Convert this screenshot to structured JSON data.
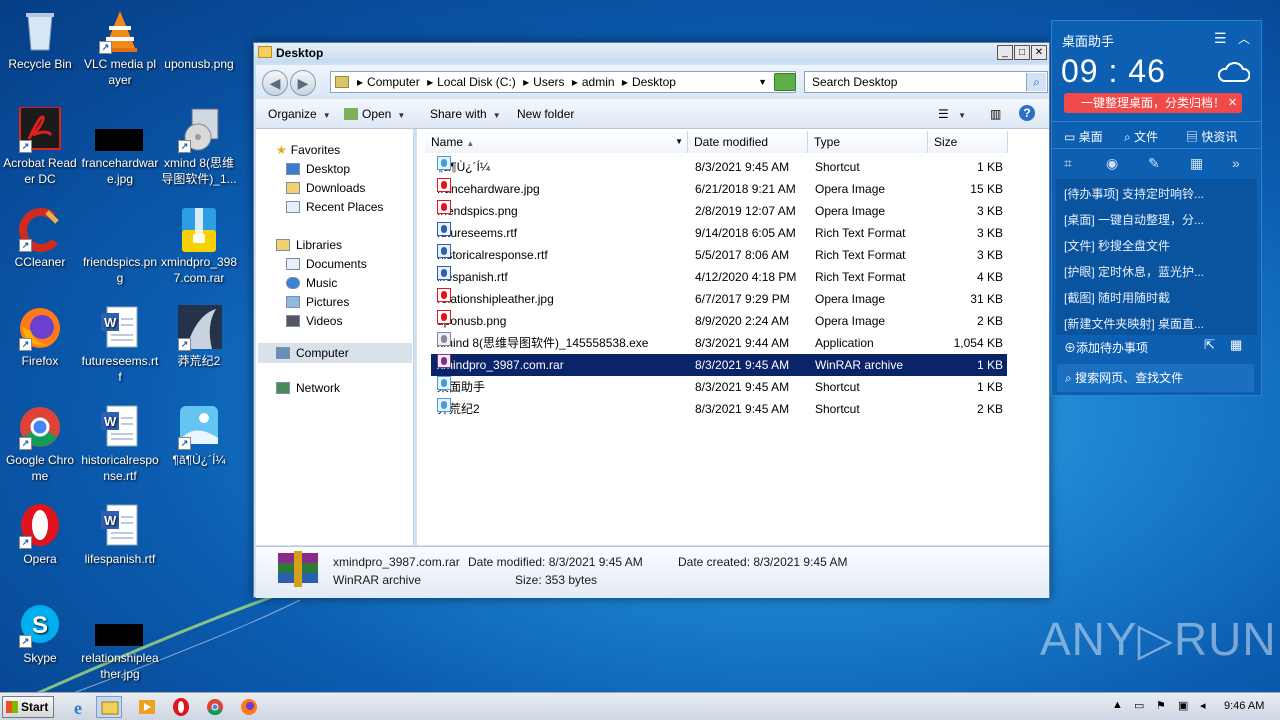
{
  "desktop": {
    "icons": [
      {
        "label": "Recycle Bin"
      },
      {
        "label": "VLC media player"
      },
      {
        "label": "uponusb.png"
      },
      {
        "label": "Acrobat Reader DC"
      },
      {
        "label": "francehardware.jpg"
      },
      {
        "label": "xmind 8(思维导图软件)_1..."
      },
      {
        "label": "CCleaner"
      },
      {
        "label": "friendspics.png"
      },
      {
        "label": "xmindpro_3987.com.rar"
      },
      {
        "label": "Firefox"
      },
      {
        "label": "futureseems.rtf"
      },
      {
        "label": "莽荒纪2"
      },
      {
        "label": "Google Chrome"
      },
      {
        "label": "historicalresponse.rtf"
      },
      {
        "label": "¶ã¶Ù¿´Í¼"
      },
      {
        "label": "Opera"
      },
      {
        "label": "lifespanish.rtf"
      },
      {
        "label": "Skype"
      },
      {
        "label": "relationshipleather.jpg"
      }
    ]
  },
  "explorer": {
    "title": "Desktop",
    "breadcrumb": [
      "Computer",
      "Local Disk (C:)",
      "Users",
      "admin",
      "Desktop"
    ],
    "search_placeholder": "Search Desktop",
    "toolbar": {
      "organize": "Organize",
      "open": "Open",
      "share_with": "Share with",
      "new_folder": "New folder"
    },
    "nav": {
      "favorites": "Favorites",
      "desktop": "Desktop",
      "downloads": "Downloads",
      "recent": "Recent Places",
      "libraries": "Libraries",
      "documents": "Documents",
      "music": "Music",
      "pictures": "Pictures",
      "videos": "Videos",
      "computer": "Computer",
      "network": "Network"
    },
    "columns": {
      "name": "Name",
      "date": "Date modified",
      "type": "Type",
      "size": "Size"
    },
    "files": [
      {
        "name": "¶ã¶Ù¿´Í¼",
        "date": "8/3/2021 9:45 AM",
        "type": "Shortcut",
        "size": "1 KB"
      },
      {
        "name": "francehardware.jpg",
        "date": "6/21/2018 9:21 AM",
        "type": "Opera Image",
        "size": "15 KB"
      },
      {
        "name": "friendspics.png",
        "date": "2/8/2019 12:07 AM",
        "type": "Opera Image",
        "size": "3 KB"
      },
      {
        "name": "futureseems.rtf",
        "date": "9/14/2018 6:05 AM",
        "type": "Rich Text Format",
        "size": "3 KB"
      },
      {
        "name": "historicalresponse.rtf",
        "date": "5/5/2017 8:06 AM",
        "type": "Rich Text Format",
        "size": "3 KB"
      },
      {
        "name": "lifespanish.rtf",
        "date": "4/12/2020 4:18 PM",
        "type": "Rich Text Format",
        "size": "4 KB"
      },
      {
        "name": "relationshipleather.jpg",
        "date": "6/7/2017 9:29 PM",
        "type": "Opera Image",
        "size": "31 KB"
      },
      {
        "name": "uponusb.png",
        "date": "8/9/2020 2:24 AM",
        "type": "Opera Image",
        "size": "2 KB"
      },
      {
        "name": "xmind 8(思维导图软件)_145558538.exe",
        "date": "8/3/2021 9:44 AM",
        "type": "Application",
        "size": "1,054 KB"
      },
      {
        "name": "xmindpro_3987.com.rar",
        "date": "8/3/2021 9:45 AM",
        "type": "WinRAR archive",
        "size": "1 KB"
      },
      {
        "name": "桌面助手",
        "date": "8/3/2021 9:45 AM",
        "type": "Shortcut",
        "size": "1 KB"
      },
      {
        "name": "莽荒纪2",
        "date": "8/3/2021 9:45 AM",
        "type": "Shortcut",
        "size": "2 KB"
      }
    ],
    "details": {
      "name": "xmindpro_3987.com.rar",
      "type": "WinRAR archive",
      "modified": "Date modified: 8/3/2021 9:45 AM",
      "created": "Date created: 8/3/2021 9:45 AM",
      "size": "Size: 353 bytes"
    }
  },
  "widget": {
    "title": "桌面助手",
    "time": "09 : 46",
    "banner": "一键整理桌面，分类归档！",
    "tabs": [
      "桌面",
      "文件",
      "快资讯"
    ],
    "items": [
      "[待办事项] 支持定时响铃...",
      "[桌面] 一键自动整理，分...",
      "[文件] 秒搜全盘文件",
      "[护眼] 定时休息，蓝光护...",
      "[截图] 随时用随时截",
      "[新建文件夹映射] 桌面直..."
    ],
    "add_todo": "添加待办事项",
    "search": "搜索网页、查找文件"
  },
  "taskbar": {
    "start": "Start",
    "clock": "9:46 AM"
  },
  "watermark": "ANY▷RUN"
}
